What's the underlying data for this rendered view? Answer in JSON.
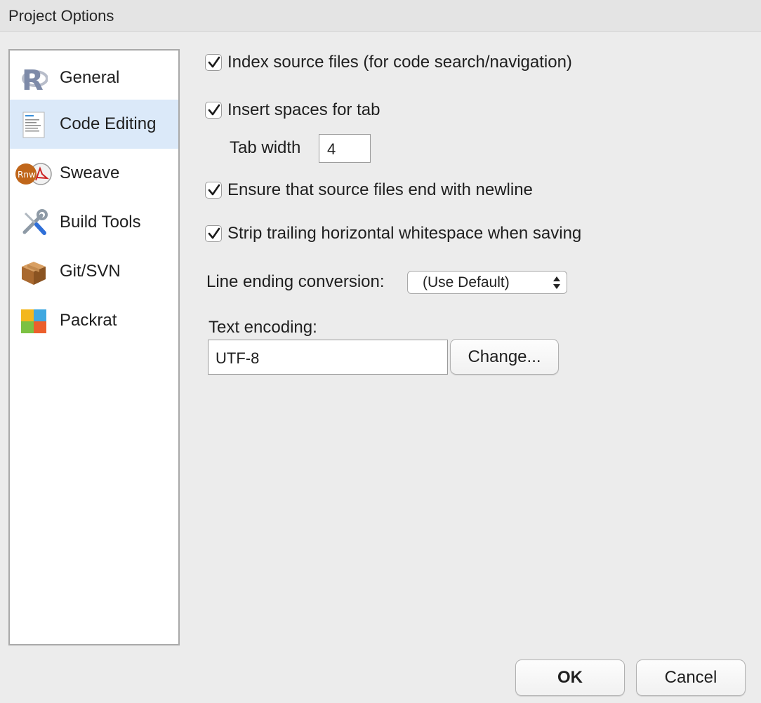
{
  "window": {
    "title": "Project Options"
  },
  "sidebar": {
    "items": [
      {
        "label": "General",
        "icon": "r-logo-icon",
        "selected": false
      },
      {
        "label": "Code Editing",
        "icon": "code-document-icon",
        "selected": true
      },
      {
        "label": "Sweave",
        "icon": "sweave-rnw-pdf-icon",
        "selected": false
      },
      {
        "label": "Build Tools",
        "icon": "wrench-screwdriver-icon",
        "selected": false
      },
      {
        "label": "Git/SVN",
        "icon": "package-box-icon",
        "selected": false
      },
      {
        "label": "Packrat",
        "icon": "packrat-blocks-icon",
        "selected": false
      }
    ]
  },
  "options": {
    "index_source": {
      "label": "Index source files (for code search/navigation)",
      "checked": true
    },
    "insert_spaces": {
      "label": "Insert spaces for tab",
      "checked": true
    },
    "tab_width": {
      "label": "Tab width",
      "value": "4"
    },
    "ensure_newline": {
      "label": "Ensure that source files end with newline",
      "checked": true
    },
    "strip_whitespace": {
      "label": "Strip trailing horizontal whitespace when saving",
      "checked": true
    },
    "line_ending": {
      "label": "Line ending conversion:",
      "value": "(Use Default)"
    },
    "text_encoding": {
      "label": "Text encoding:",
      "value": "UTF-8",
      "change_label": "Change..."
    }
  },
  "footer": {
    "ok_label": "OK",
    "cancel_label": "Cancel"
  },
  "colors": {
    "selection_bg": "#dbe9f9",
    "dialog_bg": "#ececec"
  }
}
